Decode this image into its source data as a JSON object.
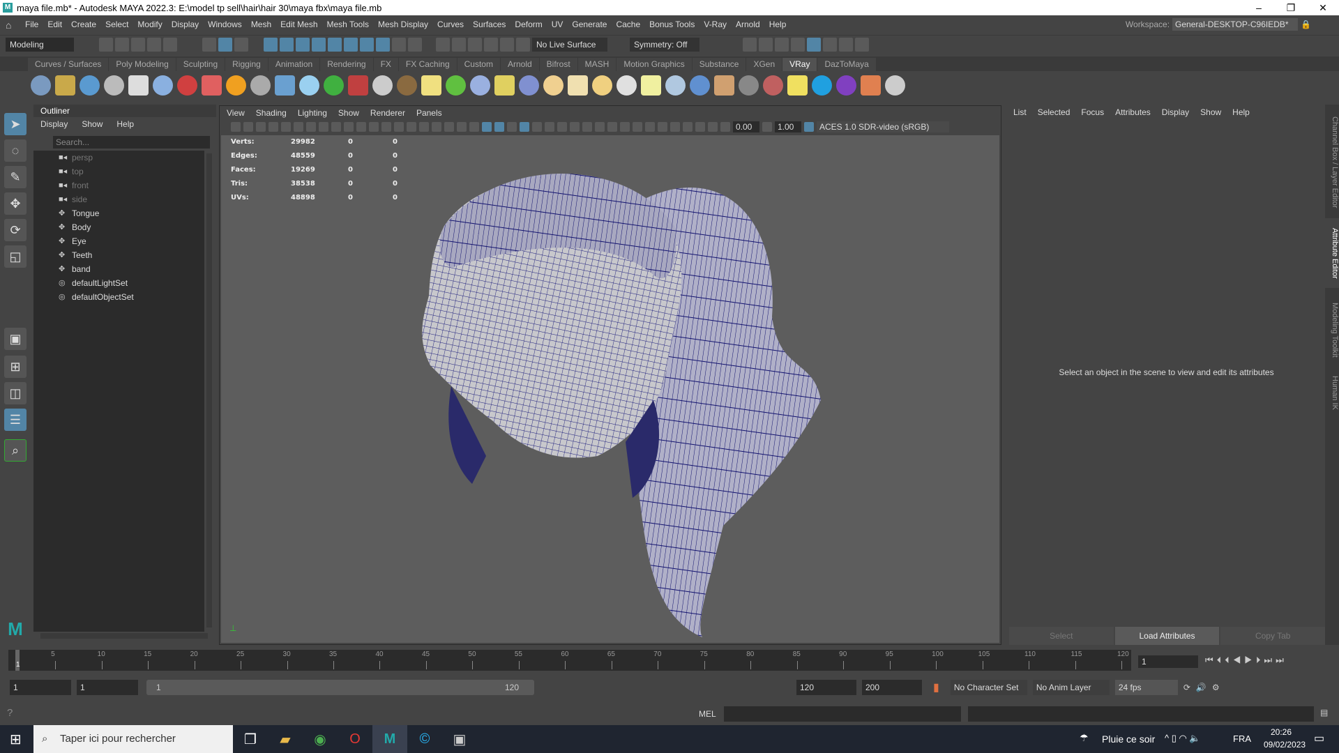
{
  "window": {
    "title": "maya file.mb* - Autodesk MAYA 2022.3: E:\\model tp sell\\hair\\hair 30\\maya fbx\\maya file.mb",
    "min": "–",
    "max": "❐",
    "close": "✕"
  },
  "menubar": [
    "File",
    "Edit",
    "Create",
    "Select",
    "Modify",
    "Display",
    "Windows",
    "Mesh",
    "Edit Mesh",
    "Mesh Tools",
    "Mesh Display",
    "Curves",
    "Surfaces",
    "Deform",
    "UV",
    "Generate",
    "Cache",
    "Bonus Tools",
    "V-Ray",
    "Arnold",
    "Help"
  ],
  "workspace": {
    "label": "Workspace:",
    "value": "General-DESKTOP-C96IEDB*"
  },
  "status": {
    "mode": "Modeling",
    "live_surface": "No Live Surface",
    "symmetry": "Symmetry: Off"
  },
  "shelf_tabs": [
    "Curves / Surfaces",
    "Poly Modeling",
    "Sculpting",
    "Rigging",
    "Animation",
    "Rendering",
    "FX",
    "FX Caching",
    "Custom",
    "Arnold",
    "Bifrost",
    "MASH",
    "Motion Graphics",
    "Substance",
    "XGen",
    "VRay",
    "DazToMaya"
  ],
  "shelf_active": "VRay",
  "outliner": {
    "title": "Outliner",
    "menu": [
      "Display",
      "Show",
      "Help"
    ],
    "search_placeholder": "Search...",
    "items": [
      {
        "label": "persp",
        "type": "camera"
      },
      {
        "label": "top",
        "type": "camera"
      },
      {
        "label": "front",
        "type": "camera"
      },
      {
        "label": "side",
        "type": "camera"
      },
      {
        "label": "Tongue",
        "type": "mesh"
      },
      {
        "label": "Body",
        "type": "mesh"
      },
      {
        "label": "Eye",
        "type": "mesh"
      },
      {
        "label": "Teeth",
        "type": "mesh"
      },
      {
        "label": "band",
        "type": "mesh"
      },
      {
        "label": "defaultLightSet",
        "type": "set"
      },
      {
        "label": "defaultObjectSet",
        "type": "set"
      }
    ]
  },
  "viewport": {
    "menu": [
      "View",
      "Shading",
      "Lighting",
      "Show",
      "Renderer",
      "Panels"
    ],
    "exposure": "0.00",
    "gamma": "1.00",
    "color_space": "ACES 1.0 SDR-video (sRGB)",
    "hud": [
      [
        "Verts:",
        "29982",
        "0",
        "0"
      ],
      [
        "Edges:",
        "48559",
        "0",
        "0"
      ],
      [
        "Faces:",
        "19269",
        "0",
        "0"
      ],
      [
        "Tris:",
        "38538",
        "0",
        "0"
      ],
      [
        "UVs:",
        "48898",
        "0",
        "0"
      ]
    ]
  },
  "attribute_editor": {
    "menu": [
      "List",
      "Selected",
      "Focus",
      "Attributes",
      "Display",
      "Show",
      "Help"
    ],
    "message": "Select an object in the scene to view and edit its attributes",
    "buttons": [
      "Select",
      "Load Attributes",
      "Copy Tab"
    ]
  },
  "side_tabs": [
    "Channel Box / Layer Editor",
    "Attribute Editor",
    "Modeling Toolkit",
    "Human IK"
  ],
  "timeline": {
    "ticks": [
      5,
      10,
      15,
      20,
      25,
      30,
      35,
      40,
      45,
      50,
      55,
      60,
      65,
      70,
      75,
      80,
      85,
      90,
      95,
      100,
      105,
      110,
      115,
      120
    ],
    "current": "1",
    "current_field": "1"
  },
  "range": {
    "start": "1",
    "anim_start": "1",
    "slider_start": "1",
    "slider_end": "120",
    "anim_end": "120",
    "end": "200",
    "character_set": "No Character Set",
    "anim_layer": "No Anim Layer",
    "fps": "24 fps"
  },
  "command": {
    "lang": "MEL"
  },
  "taskbar": {
    "search": "Taper ici pour rechercher",
    "weather": "Pluie ce soir",
    "lang": "FRA",
    "time": "20:26",
    "date": "09/02/2023"
  }
}
